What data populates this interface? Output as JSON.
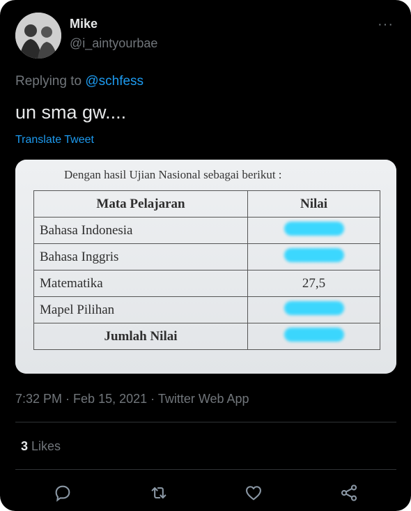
{
  "author": {
    "display_name": "Mike",
    "handle": "@i_aintyourbae"
  },
  "more_label": "···",
  "reply": {
    "prefix": "Replying to ",
    "mention": "@schfess"
  },
  "tweet": {
    "text": "un sma gw....",
    "translate_label": "Translate Tweet"
  },
  "photo": {
    "caption": "Dengan hasil Ujian Nasional sebagai berikut :",
    "table": {
      "headers": [
        "Mata Pelajaran",
        "Nilai"
      ],
      "rows": [
        {
          "subject": "Bahasa Indonesia",
          "score": ""
        },
        {
          "subject": "Bahasa Inggris",
          "score": ""
        },
        {
          "subject": "Matematika",
          "score": "27,5"
        },
        {
          "subject": "Mapel Pilihan",
          "score": ""
        }
      ],
      "total_label": "Jumlah Nilai"
    },
    "redaction_color": "#33d6ff"
  },
  "meta": {
    "time": "7:32 PM",
    "sep1": " · ",
    "date": "Feb 15, 2021",
    "sep2": " · ",
    "source": "Twitter Web App"
  },
  "stats": {
    "likes_count": "3",
    "likes_label": " Likes"
  },
  "actions": [
    "reply-icon",
    "retweet-icon",
    "like-icon",
    "share-icon"
  ],
  "colors": {
    "background": "#000000",
    "text": "#e7e9ea",
    "muted": "#71767b",
    "link": "#1d9bf0"
  }
}
